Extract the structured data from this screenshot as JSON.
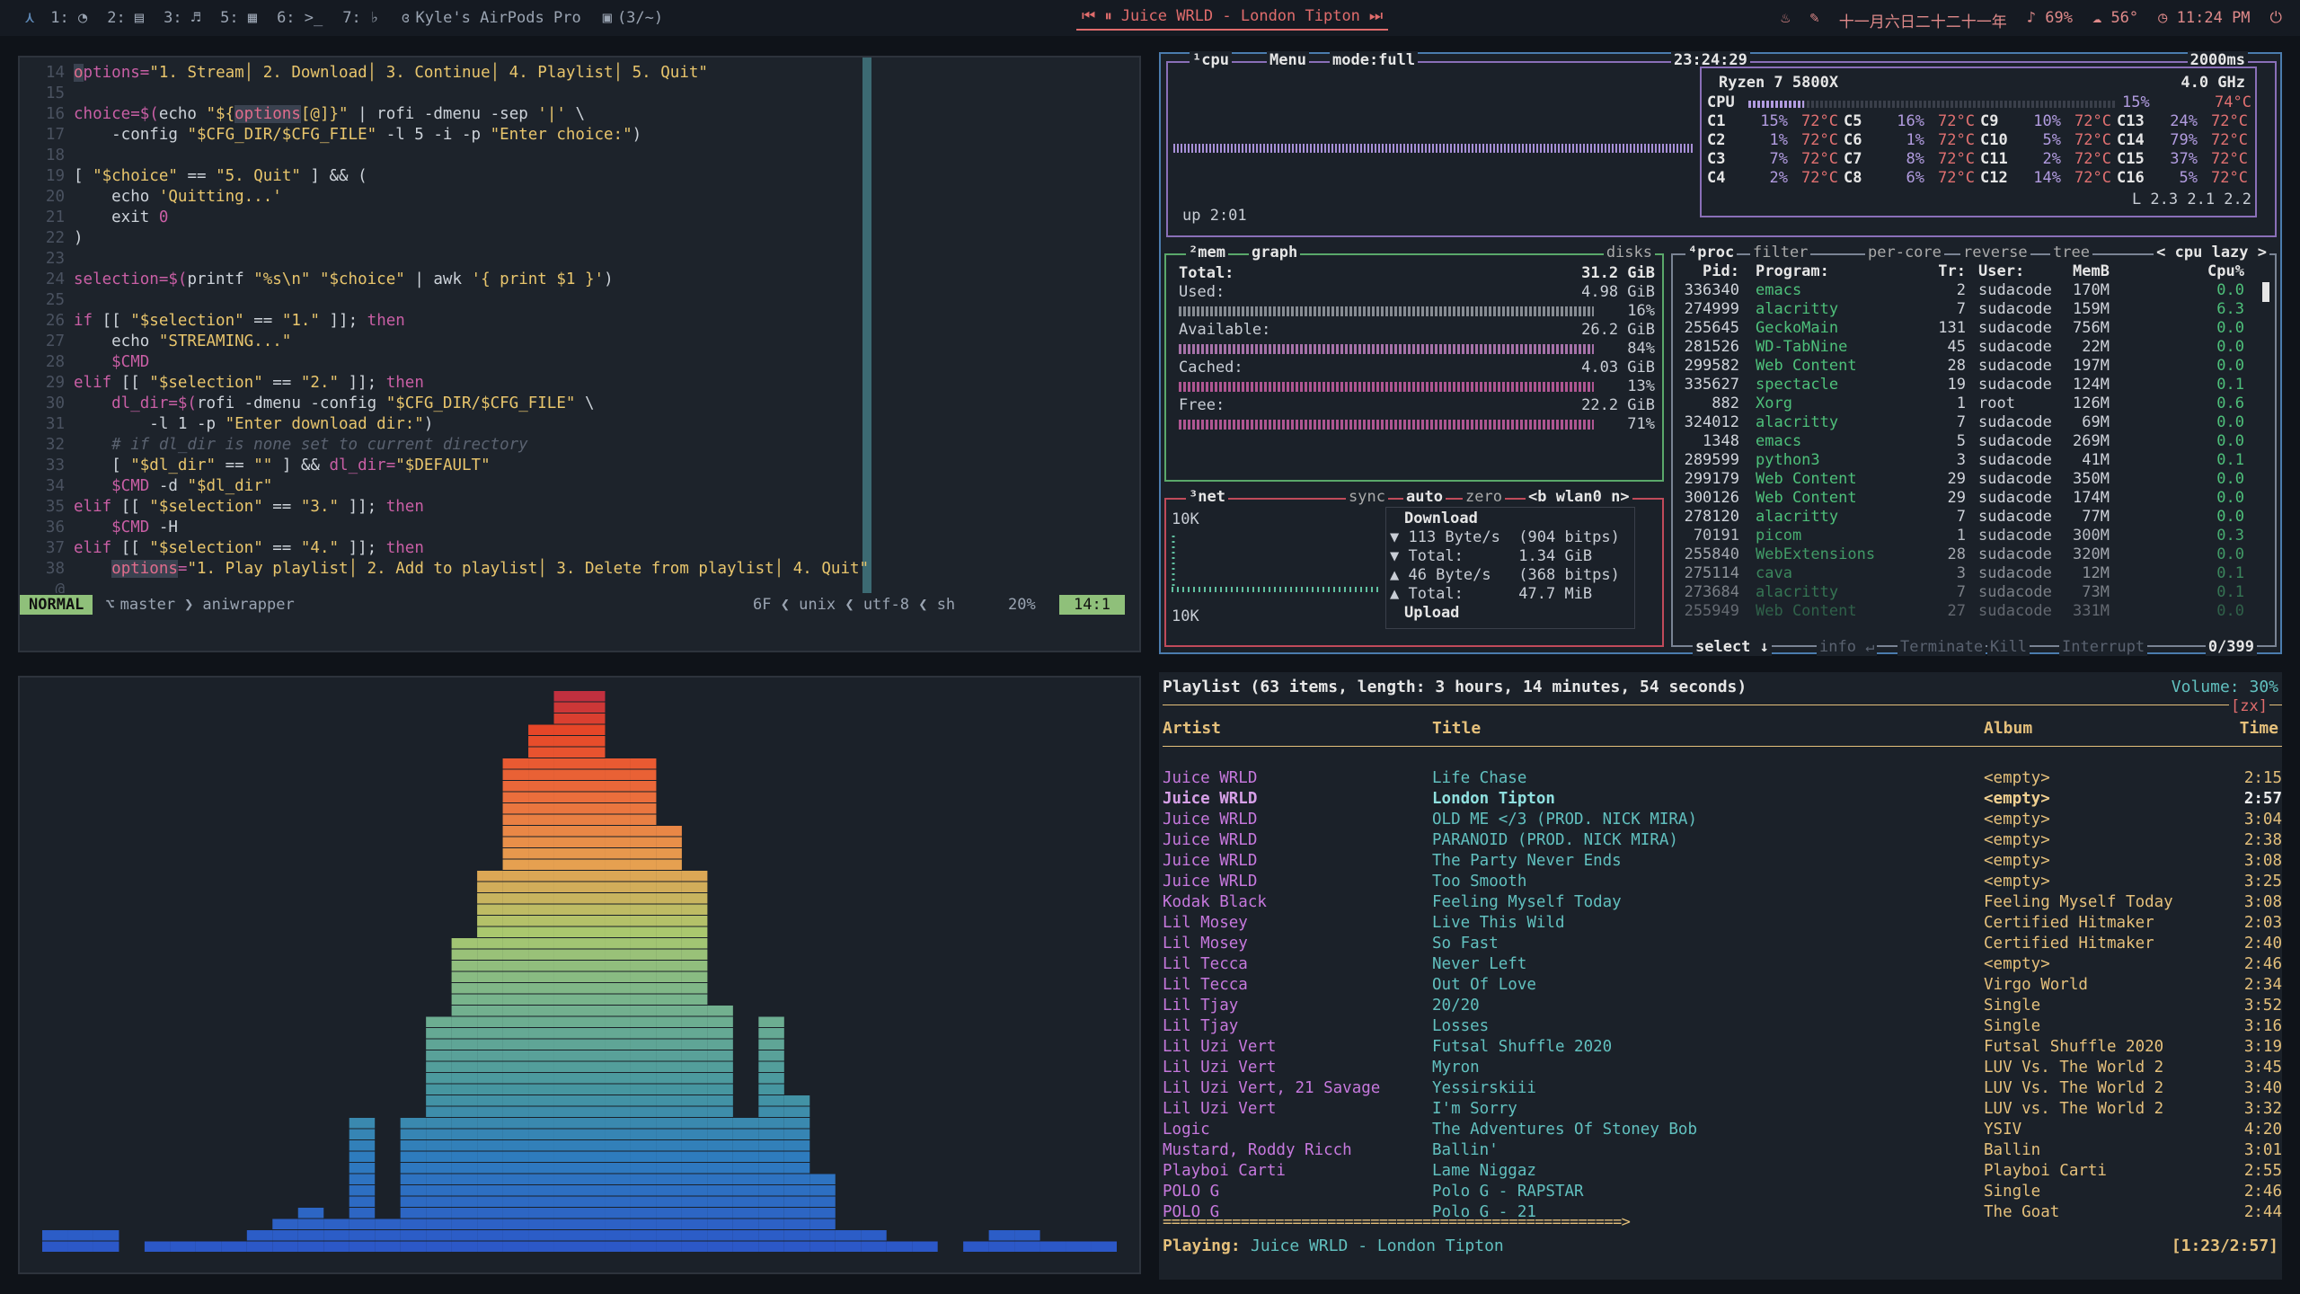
{
  "topbar": {
    "workspaces": [
      "1: ◔",
      "2: ▤",
      "3: ♬",
      "5: ▦",
      "6: >_",
      "7: ♭"
    ],
    "bluetooth": "Kyle's AirPods Pro",
    "updates": "(3/~)",
    "now_playing": "Juice WRLD - London Tipton",
    "date": "十一月六日二十二十一年",
    "volume": "69%",
    "weather": "56°",
    "time": "11:24 PM"
  },
  "nvim": {
    "lines": [
      {
        "n": "14",
        "segs": [
          [
            "hl",
            "o"
          ],
          [
            "",
            "ptions="
          ],
          [
            "s",
            "\"1. Stream│ 2. Download│ 3. Continue│ 4. Playlist│ 5. Quit\""
          ]
        ]
      },
      {
        "n": "15",
        "segs": []
      },
      {
        "n": "16",
        "segs": [
          [
            "",
            "choice=$("
          ],
          [
            "w",
            "echo "
          ],
          [
            "s",
            "\"${"
          ],
          [
            "hl",
            "options"
          ],
          [
            "s",
            "[@]}\""
          ],
          [
            "w",
            " | rofi -dmenu -sep "
          ],
          [
            "s",
            "'|'"
          ],
          [
            "w",
            " \\"
          ]
        ]
      },
      {
        "n": "17",
        "segs": [
          [
            "w",
            "    -config "
          ],
          [
            "s",
            "\"$CFG_DIR/$CFG_FILE\""
          ],
          [
            "w",
            " -l 5 -i -p "
          ],
          [
            "s",
            "\"Enter choice:\""
          ],
          [
            "w",
            ")"
          ]
        ]
      },
      {
        "n": "18",
        "segs": []
      },
      {
        "n": "19",
        "segs": [
          [
            "w",
            "[ "
          ],
          [
            "s",
            "\"$choice\""
          ],
          [
            "w",
            " == "
          ],
          [
            "s",
            "\"5. Quit\""
          ],
          [
            "w",
            " ] && ("
          ]
        ]
      },
      {
        "n": "20",
        "segs": [
          [
            "w",
            "    echo "
          ],
          [
            "s",
            "'Quitting...'"
          ]
        ]
      },
      {
        "n": "21",
        "segs": [
          [
            "w",
            "    exit "
          ],
          [
            "",
            "0"
          ]
        ]
      },
      {
        "n": "22",
        "segs": [
          [
            "w",
            ")"
          ]
        ]
      },
      {
        "n": "23",
        "segs": []
      },
      {
        "n": "24",
        "segs": [
          [
            "",
            "selection=$("
          ],
          [
            "w",
            "printf "
          ],
          [
            "s",
            "\"%s\\n\" \"$choice\""
          ],
          [
            "w",
            " | awk "
          ],
          [
            "s",
            "'{ print $1 }'"
          ],
          [
            "w",
            ")"
          ]
        ]
      },
      {
        "n": "25",
        "segs": []
      },
      {
        "n": "26",
        "segs": [
          [
            "",
            "if "
          ],
          [
            "w",
            "[[ "
          ],
          [
            "s",
            "\"$selection\""
          ],
          [
            "w",
            " == "
          ],
          [
            "s",
            "\"1.\""
          ],
          [
            "w",
            " ]]; "
          ],
          [
            "",
            "then"
          ]
        ]
      },
      {
        "n": "27",
        "segs": [
          [
            "w",
            "    echo "
          ],
          [
            "s",
            "\"STREAMING...\""
          ]
        ]
      },
      {
        "n": "28",
        "segs": [
          [
            "",
            "    $CMD"
          ]
        ]
      },
      {
        "n": "29",
        "segs": [
          [
            "",
            "elif "
          ],
          [
            "w",
            "[[ "
          ],
          [
            "s",
            "\"$selection\""
          ],
          [
            "w",
            " == "
          ],
          [
            "s",
            "\"2.\""
          ],
          [
            "w",
            " ]]; "
          ],
          [
            "",
            "then"
          ]
        ]
      },
      {
        "n": "30",
        "segs": [
          [
            "",
            "    dl_dir=$("
          ],
          [
            "w",
            "rofi -dmenu -config "
          ],
          [
            "s",
            "\"$CFG_DIR/$CFG_FILE\""
          ],
          [
            "w",
            " \\"
          ]
        ]
      },
      {
        "n": "31",
        "segs": [
          [
            "w",
            "        -l 1 -p "
          ],
          [
            "s",
            "\"Enter download dir:\""
          ],
          [
            "w",
            ")"
          ]
        ]
      },
      {
        "n": "32",
        "segs": [
          [
            "c",
            "    # if dl_dir is none set to current directory"
          ]
        ]
      },
      {
        "n": "33",
        "segs": [
          [
            "w",
            "    [ "
          ],
          [
            "s",
            "\"$dl_dir\""
          ],
          [
            "w",
            " == "
          ],
          [
            "s",
            "\"\""
          ],
          [
            "w",
            " ] && "
          ],
          [
            "",
            "dl_dir="
          ],
          [
            "s",
            "\"$DEFAULT\""
          ]
        ]
      },
      {
        "n": "34",
        "segs": [
          [
            "",
            "    $CMD "
          ],
          [
            "w",
            "-d "
          ],
          [
            "s",
            "\"$dl_dir\""
          ]
        ]
      },
      {
        "n": "35",
        "segs": [
          [
            "",
            "elif "
          ],
          [
            "w",
            "[[ "
          ],
          [
            "s",
            "\"$selection\""
          ],
          [
            "w",
            " == "
          ],
          [
            "s",
            "\"3.\""
          ],
          [
            "w",
            " ]]; "
          ],
          [
            "",
            "then"
          ]
        ]
      },
      {
        "n": "36",
        "segs": [
          [
            "",
            "    $CMD "
          ],
          [
            "w",
            "-H"
          ]
        ]
      },
      {
        "n": "37",
        "segs": [
          [
            "",
            "elif "
          ],
          [
            "w",
            "[[ "
          ],
          [
            "s",
            "\"$selection\""
          ],
          [
            "w",
            " == "
          ],
          [
            "s",
            "\"4.\""
          ],
          [
            "w",
            " ]]; "
          ],
          [
            "",
            "then"
          ]
        ]
      },
      {
        "n": "38",
        "segs": [
          [
            "",
            "    "
          ],
          [
            "hl",
            "options"
          ],
          [
            "",
            "="
          ],
          [
            "s",
            "\"1. Play playlist│ 2. Add to playlist│ 3. Delete from playlist│ 4. Quit\""
          ]
        ]
      },
      {
        "n": "@",
        "segs": []
      }
    ],
    "status": {
      "mode": "NORMAL",
      "branch": "master",
      "file": "aniwrapper",
      "info": "6F ❮ unix ❮ utf-8 ❮ sh",
      "percent": "20%",
      "pos": "14:1"
    }
  },
  "btop": {
    "cpu": {
      "labels": [
        "¹cpu",
        "Menu",
        "mode:full"
      ],
      "clock": "23:24:29",
      "interval": "2000ms",
      "model": "Ryzen 7 5800X",
      "freq": "4.0 GHz",
      "total": "CPU",
      "total_pct": "15%",
      "total_temp": "74°C",
      "uptime": "up 2:01",
      "load": "L 2.3 2.1 2.2",
      "cores": [
        [
          "C1",
          "15%",
          "72°C"
        ],
        [
          "C5",
          "16%",
          "72°C"
        ],
        [
          "C9",
          "10%",
          "72°C"
        ],
        [
          "C13",
          "24%",
          "72°C"
        ],
        [
          "C2",
          "1%",
          "72°C"
        ],
        [
          "C6",
          "1%",
          "72°C"
        ],
        [
          "C10",
          "5%",
          "72°C"
        ],
        [
          "C14",
          "79%",
          "72°C"
        ],
        [
          "C3",
          "7%",
          "72°C"
        ],
        [
          "C7",
          "8%",
          "72°C"
        ],
        [
          "C11",
          "2%",
          "72°C"
        ],
        [
          "C15",
          "37%",
          "72°C"
        ],
        [
          "C4",
          "2%",
          "72°C"
        ],
        [
          "C8",
          "6%",
          "72°C"
        ],
        [
          "C12",
          "14%",
          "72°C"
        ],
        [
          "C16",
          "5%",
          "72°C"
        ]
      ]
    },
    "mem": {
      "labels": [
        "²mem",
        "graph",
        "disks"
      ],
      "rows": [
        [
          "Total:",
          "31.2 GiB"
        ],
        [
          "Used:",
          "4.98 GiB"
        ],
        [
          "",
          "16%"
        ],
        [
          "Available:",
          "26.2 GiB"
        ],
        [
          "",
          "84%"
        ],
        [
          "Cached:",
          "4.03 GiB"
        ],
        [
          "",
          "13%"
        ],
        [
          "Free:",
          "22.2 GiB"
        ],
        [
          "",
          "71%"
        ]
      ]
    },
    "net": {
      "labels": [
        "³net",
        "sync",
        "auto",
        "zero",
        "<b wlan0 n>"
      ],
      "scale_top": "10K",
      "scale_bot": "10K",
      "download": "Download",
      "down_rate": "▼ 113 Byte/s  (904 bitps)",
      "down_total": "▼ Total:      1.34 GiB",
      "up_rate": "▲ 46 Byte/s   (368 bitps)",
      "up_total": "▲ Total:      47.7 MiB",
      "upload": "Upload"
    },
    "proc": {
      "labels": [
        "⁴proc",
        "filter",
        "per-core",
        "reverse",
        "tree",
        "< cpu lazy >"
      ],
      "headers": [
        "Pid:",
        "Program:",
        "Tr:",
        "User:",
        "MemB",
        "Cpu%"
      ],
      "rows": [
        [
          "336340",
          "emacs",
          "2",
          "sudacode",
          "170M",
          "0.0"
        ],
        [
          "274999",
          "alacritty",
          "7",
          "sudacode",
          "159M",
          "6.3"
        ],
        [
          "255645",
          "GeckoMain",
          "131",
          "sudacode",
          "756M",
          "0.0"
        ],
        [
          "281526",
          "WD-TabNine",
          "45",
          "sudacode",
          "22M",
          "0.0"
        ],
        [
          "299582",
          "Web Content",
          "28",
          "sudacode",
          "197M",
          "0.0"
        ],
        [
          "335627",
          "spectacle",
          "19",
          "sudacode",
          "124M",
          "0.1"
        ],
        [
          "882",
          "Xorg",
          "1",
          "root",
          "126M",
          "0.6"
        ],
        [
          "324012",
          "alacritty",
          "7",
          "sudacode",
          "69M",
          "0.0"
        ],
        [
          "1348",
          "emacs",
          "5",
          "sudacode",
          "269M",
          "0.0"
        ],
        [
          "289599",
          "python3",
          "3",
          "sudacode",
          "41M",
          "0.1"
        ],
        [
          "299179",
          "Web Content",
          "29",
          "sudacode",
          "350M",
          "0.0"
        ],
        [
          "300126",
          "Web Content",
          "29",
          "sudacode",
          "174M",
          "0.0"
        ],
        [
          "278120",
          "alacritty",
          "7",
          "sudacode",
          "77M",
          "0.0"
        ],
        [
          "70191",
          "picom",
          "1",
          "sudacode",
          "300M",
          "0.3"
        ],
        [
          "255840",
          "WebExtensions",
          "28",
          "sudacode",
          "320M",
          "0.0"
        ],
        [
          "275114",
          "cava",
          "3",
          "sudacode",
          "12M",
          "0.1"
        ],
        [
          "273684",
          "alacritty",
          "7",
          "sudacode",
          "73M",
          "0.1"
        ],
        [
          "255949",
          "Web Content",
          "27",
          "sudacode",
          "331M",
          "0.0"
        ]
      ],
      "footer": [
        "select ↓",
        "info ↵",
        "Terminate",
        "Kill",
        "Interrupt"
      ],
      "count": "0/399"
    }
  },
  "visualizer": {
    "bars": [
      2,
      2,
      2,
      0,
      1,
      1,
      1,
      1,
      2,
      3,
      4,
      3,
      12,
      3,
      12,
      21,
      28,
      34,
      44,
      47,
      50,
      50,
      44,
      44,
      38,
      34,
      22,
      12,
      21,
      14,
      7,
      2,
      2,
      1,
      1,
      0,
      1,
      2,
      2,
      1,
      1,
      1
    ]
  },
  "ncmpcpp": {
    "header": "Playlist (63 items, length: 3 hours, 14 minutes, 54 seconds)",
    "volume": "Volume: 30%",
    "flags": "[zx]",
    "columns": [
      "Artist",
      "Title",
      "Album",
      "Time"
    ],
    "tracks": [
      [
        "Juice WRLD",
        "Life Chase",
        "<empty>",
        "2:15"
      ],
      [
        "Juice WRLD",
        "London Tipton",
        "<empty>",
        "2:57"
      ],
      [
        "Juice WRLD",
        "OLD ME </3 (PROD. NICK MIRA)",
        "<empty>",
        "3:04"
      ],
      [
        "Juice WRLD",
        "PARANOID (PROD. NICK MIRA)",
        "<empty>",
        "2:38"
      ],
      [
        "Juice WRLD",
        "The Party Never Ends",
        "<empty>",
        "3:08"
      ],
      [
        "Juice WRLD",
        "Too Smooth",
        "<empty>",
        "3:25"
      ],
      [
        "Kodak Black",
        "Feeling Myself Today",
        "Feeling Myself Today",
        "3:08"
      ],
      [
        "Lil Mosey",
        "Live This Wild",
        "Certified Hitmaker",
        "2:03"
      ],
      [
        "Lil Mosey",
        "So Fast",
        "Certified Hitmaker",
        "2:40"
      ],
      [
        "Lil Tecca",
        "Never Left",
        "<empty>",
        "2:46"
      ],
      [
        "Lil Tecca",
        "Out Of Love",
        "Virgo World",
        "2:34"
      ],
      [
        "Lil Tjay",
        "20/20",
        "Single",
        "3:52"
      ],
      [
        "Lil Tjay",
        "Losses",
        "Single",
        "3:16"
      ],
      [
        "Lil Uzi Vert",
        "Futsal Shuffle 2020",
        "Futsal Shuffle 2020",
        "3:19"
      ],
      [
        "Lil Uzi Vert",
        "Myron",
        "LUV Vs. The World 2",
        "3:45"
      ],
      [
        "Lil Uzi Vert, 21 Savage",
        "Yessirskiii",
        "LUV Vs. The World 2",
        "3:40"
      ],
      [
        "Lil Uzi Vert",
        "I'm Sorry",
        "LUV vs. The World 2",
        "3:32"
      ],
      [
        "Logic",
        "The Adventures Of Stoney Bob",
        "YSIV",
        "4:20"
      ],
      [
        "Mustard, Roddy Ricch",
        "Ballin'",
        "Ballin",
        "3:01"
      ],
      [
        "Playboi Carti",
        "Lame Niggaz",
        "Playboi Carti",
        "2:55"
      ],
      [
        "POLO G",
        "Polo G - RAPSTAR",
        "Single",
        "2:46"
      ],
      [
        "POLO G",
        "Polo G - 21",
        "The Goat",
        "2:44"
      ]
    ],
    "current_index": 1,
    "progress_bar": "=====================================================>",
    "playing_label": "Playing:",
    "playing": "Juice WRLD - London Tipton",
    "elapsed": "[1:23/2:57]",
    "progress": 0.469
  }
}
